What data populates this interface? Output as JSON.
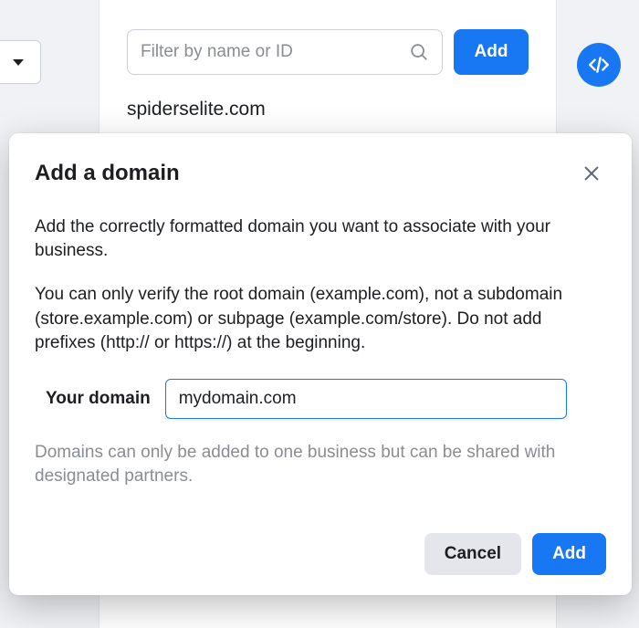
{
  "background": {
    "filter_placeholder": "Filter by name or ID",
    "add_label": "Add",
    "listed_domain": "spiderselite.com",
    "code_icon_label": "</>"
  },
  "modal": {
    "title": "Add a domain",
    "paragraph1": "Add the correctly formatted domain you want to associate with your business.",
    "paragraph2": "You can only verify the root domain (example.com), not a subdomain (store.example.com) or subpage (example.com/store). Do not add prefixes (http:// or https://) at the beginning.",
    "field_label": "Your domain",
    "field_value": "mydomain.com",
    "helper_text": "Domains can only be added to one business but can be shared with designated partners.",
    "cancel_label": "Cancel",
    "add_label": "Add"
  }
}
